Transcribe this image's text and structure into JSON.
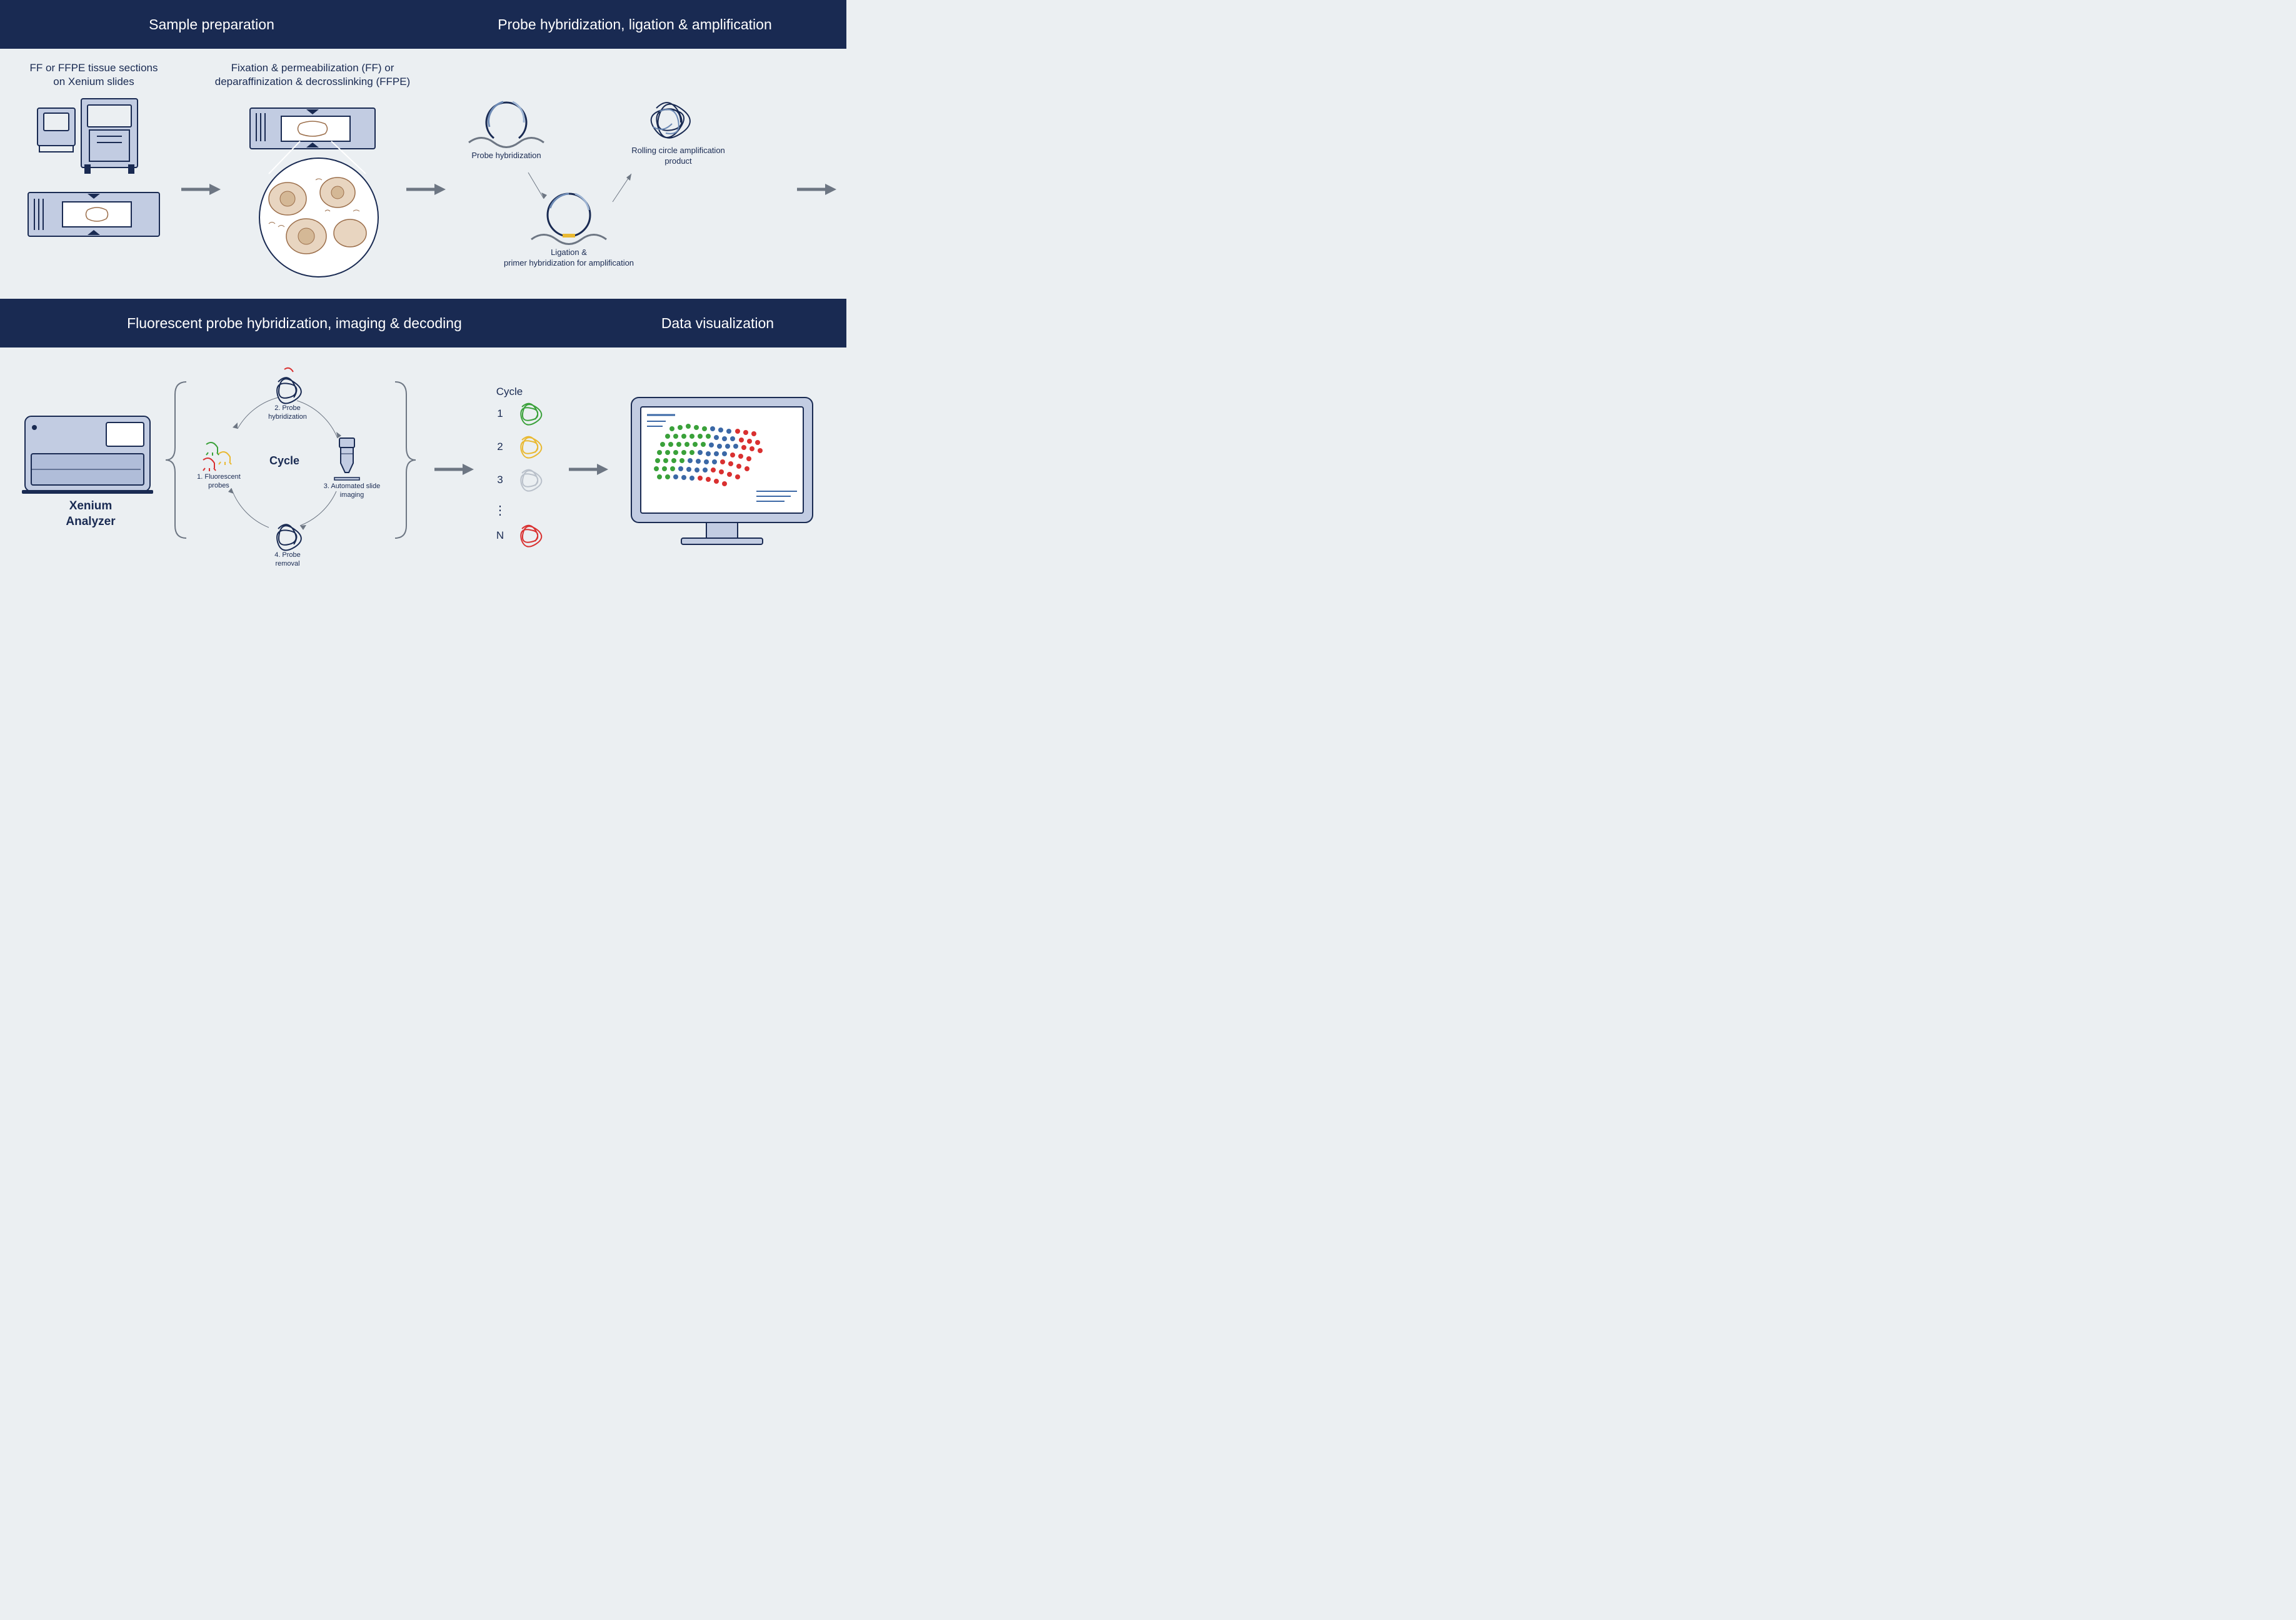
{
  "headers": {
    "sample_prep": "Sample preparation",
    "probe_hyb": "Probe hybridization, ligation & amplification",
    "fluor": "Fluorescent probe hybridization, imaging & decoding",
    "viz": "Data visualization"
  },
  "row1": {
    "col1_title": "FF or FFPE tissue sections\non Xenium slides",
    "col2_title": "Fixation & permeabilization (FF) or\ndeparaffinization & decrosslinking (FFPE)",
    "probe_hyb": "Probe hybridization",
    "rca": "Rolling circle amplification\nproduct",
    "ligation": "Ligation &\nprimer hybridization for amplification"
  },
  "row2": {
    "analyzer": "Xenium\nAnalyzer",
    "cycle_center": "Cycle",
    "step1": "1. Fluorescent\nprobes",
    "step2": "2. Probe\nhybridization",
    "step3": "3. Automated slide\nimaging",
    "step4": "4. Probe\nremoval",
    "cycle_col": "Cycle",
    "n1": "1",
    "n2": "2",
    "n3": "3",
    "dots": "⋮",
    "nN": "N"
  },
  "colors": {
    "navy": "#192a52",
    "slate": "#6d7683",
    "blue": "#3b68a6",
    "lblue": "#c2cce2",
    "green": "#3aa13a",
    "yellow": "#e9b932",
    "red": "#d93030",
    "grey": "#b9c0ca",
    "brown": "#9b6e4a"
  }
}
